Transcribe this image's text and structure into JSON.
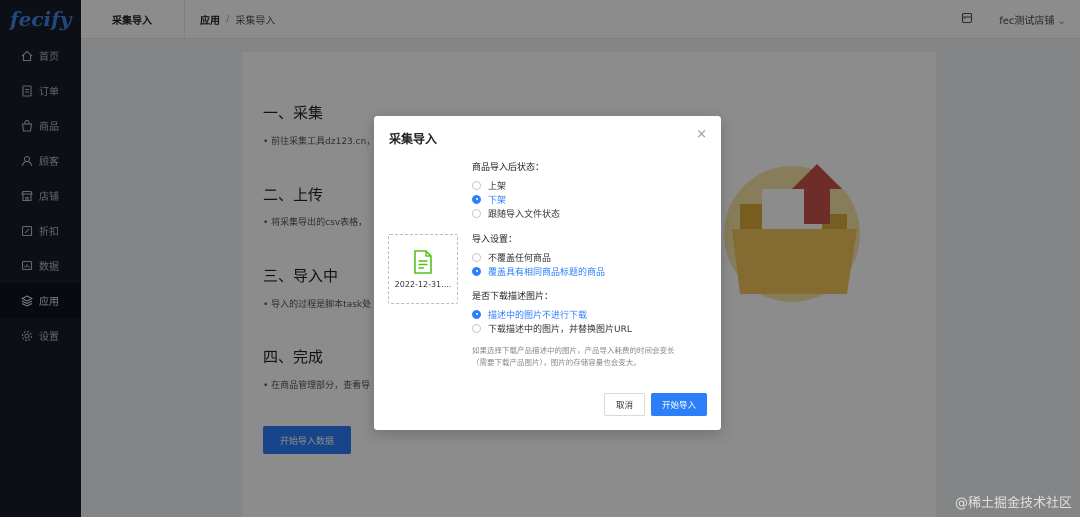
{
  "app": {
    "logo": "fecify"
  },
  "sidebar": {
    "items": [
      {
        "label": "首页",
        "icon": "home-icon"
      },
      {
        "label": "订单",
        "icon": "order-icon"
      },
      {
        "label": "商品",
        "icon": "product-icon"
      },
      {
        "label": "顾客",
        "icon": "customer-icon"
      },
      {
        "label": "店铺",
        "icon": "store-icon"
      },
      {
        "label": "折扣",
        "icon": "discount-icon"
      },
      {
        "label": "数据",
        "icon": "data-icon"
      },
      {
        "label": "应用",
        "icon": "app-icon",
        "active": true
      },
      {
        "label": "设置",
        "icon": "settings-icon"
      }
    ]
  },
  "header": {
    "page_title": "采集导入",
    "breadcrumb": {
      "parent": "应用",
      "separator": "/",
      "current": "采集导入"
    },
    "store_name": "fec测试店铺"
  },
  "main": {
    "steps": [
      {
        "title": "一、采集",
        "text": "前往采集工具dz123.cn，"
      },
      {
        "title": "二、上传",
        "text": "将采集导出的csv表格，"
      },
      {
        "title": "三、导入中",
        "text": "导入的过程是脚本task处"
      },
      {
        "title": "四、完成",
        "text": "在商品管理部分，查看导"
      }
    ],
    "start_button": "开始导入数据"
  },
  "modal": {
    "title": "采集导入",
    "close": "×",
    "file_name": "2022-12-31....",
    "status_label": "商品导入后状态：",
    "status_options": [
      {
        "label": "上架",
        "checked": false
      },
      {
        "label": "下架",
        "checked": true
      },
      {
        "label": "跟随导入文件状态",
        "checked": false
      }
    ],
    "import_label": "导入设置：",
    "import_options": [
      {
        "label": "不覆盖任何商品",
        "checked": false
      },
      {
        "label": "覆盖具有相同商品标题的商品",
        "checked": true
      }
    ],
    "image_label": "是否下载描述图片：",
    "image_options": [
      {
        "label": "描述中的图片不进行下载",
        "checked": true
      },
      {
        "label": "下载描述中的图片，并替换图片URL",
        "checked": false
      }
    ],
    "note_line1": "如果选择下载产品描述中的图片，产品导入耗费的时间会变长",
    "note_line2": "（需要下载产品图片），图片的存储容量也会变大。",
    "cancel": "取消",
    "confirm": "开始导入"
  },
  "watermark": "@稀土掘金技术社区",
  "colors": {
    "accent": "#2d7ff9",
    "sidebar_bg": "#161d29",
    "file_icon": "#52c41a"
  }
}
